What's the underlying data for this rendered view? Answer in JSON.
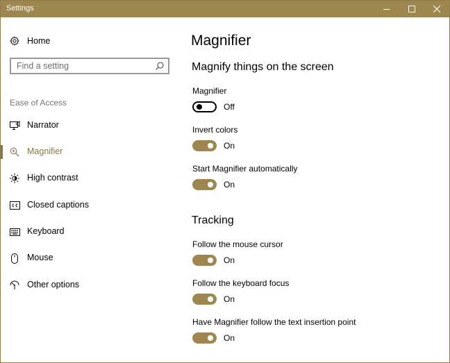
{
  "window": {
    "title": "Settings",
    "colors": {
      "accent": "#9d874f",
      "selected_text": "#8a7744",
      "titlebar_text": "#ffffff"
    }
  },
  "sidebar": {
    "home_label": "Home",
    "search": {
      "placeholder": "Find a setting"
    },
    "section_heading": "Ease of Access",
    "items": [
      {
        "label": "Narrator",
        "icon": "narrator-icon"
      },
      {
        "label": "Magnifier",
        "icon": "magnifier-icon",
        "selected": true
      },
      {
        "label": "High contrast",
        "icon": "high-contrast-icon"
      },
      {
        "label": "Closed captions",
        "icon": "closed-captions-icon"
      },
      {
        "label": "Keyboard",
        "icon": "keyboard-icon"
      },
      {
        "label": "Mouse",
        "icon": "mouse-icon"
      },
      {
        "label": "Other options",
        "icon": "other-options-icon"
      }
    ]
  },
  "main": {
    "page_title": "Magnifier",
    "sections": [
      {
        "title": "Magnify things on the screen",
        "settings": [
          {
            "label": "Magnifier",
            "state": "Off"
          },
          {
            "label": "Invert colors",
            "state": "On"
          },
          {
            "label": "Start Magnifier automatically",
            "state": "On"
          }
        ]
      },
      {
        "title": "Tracking",
        "settings": [
          {
            "label": "Follow the mouse cursor",
            "state": "On"
          },
          {
            "label": "Follow the keyboard focus",
            "state": "On"
          },
          {
            "label": "Have Magnifier follow the text insertion point",
            "state": "On"
          }
        ]
      }
    ]
  }
}
